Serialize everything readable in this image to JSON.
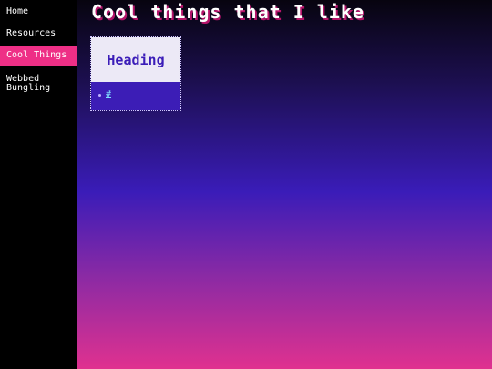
{
  "sidebar": {
    "items": [
      {
        "label": "Home",
        "active": false
      },
      {
        "label": "Resources",
        "active": false
      },
      {
        "label": "Cool Things",
        "active": true
      },
      {
        "label": "Webbed Bungling",
        "active": false
      }
    ]
  },
  "main": {
    "title": "Cool things that I like",
    "card": {
      "heading": "Heading",
      "link_text": "#"
    }
  },
  "colors": {
    "active_nav": "#ee2f86",
    "card_body": "#3c1db6",
    "heading_text": "#3b1db8",
    "link": "#7fe0ff"
  }
}
